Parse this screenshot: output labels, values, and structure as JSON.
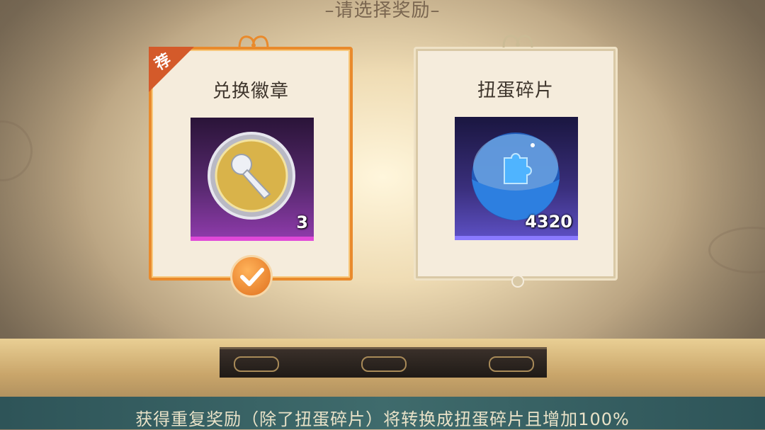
{
  "title": "–请选择奖励–",
  "options": [
    {
      "name": "兑换徽章",
      "count": "3",
      "badge": "荐",
      "selected": true,
      "icon": "badge-coin-icon",
      "rarity_color": "#e048d8"
    },
    {
      "name": "扭蛋碎片",
      "count": "4320",
      "selected": false,
      "icon": "puzzle-orb-icon",
      "rarity_color": "#8a7aff"
    }
  ],
  "tip": "获得重复奖励（除了扭蛋碎片）将转换成扭蛋碎片且增加100%",
  "colors": {
    "selected_border": "#e98a2c",
    "tip_bar": "#3f6b6c"
  }
}
